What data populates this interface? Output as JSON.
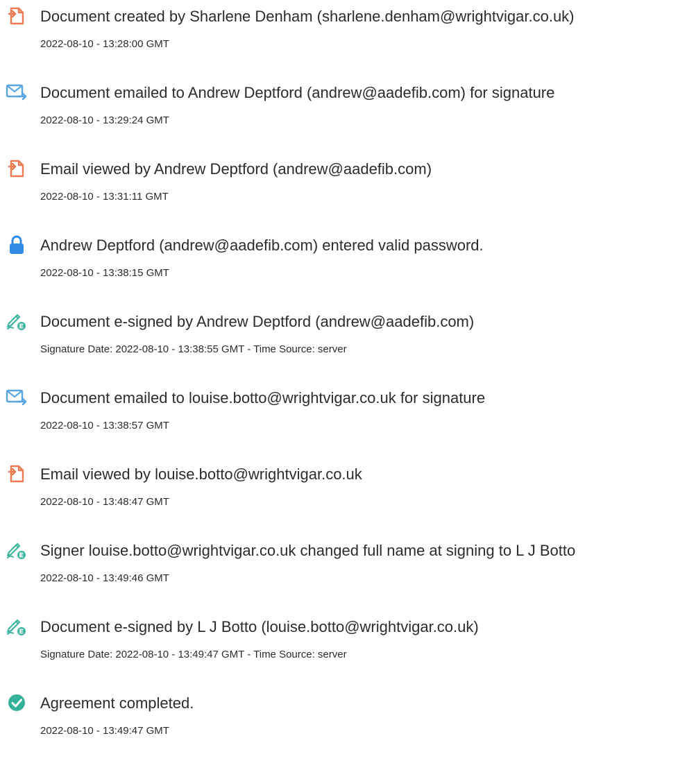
{
  "events": [
    {
      "icon": "document-icon",
      "title": "Document created by Sharlene Denham (sharlene.denham@wrightvigar.co.uk)",
      "meta": "2022-08-10 - 13:28:00 GMT"
    },
    {
      "icon": "email-sent-icon",
      "title": "Document emailed to Andrew Deptford (andrew@aadefib.com) for signature",
      "meta": "2022-08-10 - 13:29:24 GMT"
    },
    {
      "icon": "document-icon",
      "title": "Email viewed by Andrew Deptford (andrew@aadefib.com)",
      "meta": "2022-08-10 - 13:31:11 GMT"
    },
    {
      "icon": "lock-icon",
      "title": "Andrew Deptford (andrew@aadefib.com) entered valid password.",
      "meta": "2022-08-10 - 13:38:15 GMT"
    },
    {
      "icon": "e-sign-pen-icon",
      "title": "Document e-signed by Andrew Deptford (andrew@aadefib.com)",
      "meta": "Signature Date: 2022-08-10 - 13:38:55 GMT - Time Source: server"
    },
    {
      "icon": "email-sent-icon",
      "title": "Document emailed to louise.botto@wrightvigar.co.uk for signature",
      "meta": "2022-08-10 - 13:38:57 GMT"
    },
    {
      "icon": "document-icon",
      "title": "Email viewed by louise.botto@wrightvigar.co.uk",
      "meta": "2022-08-10 - 13:48:47 GMT"
    },
    {
      "icon": "e-sign-pen-icon",
      "title": "Signer louise.botto@wrightvigar.co.uk changed full name at signing to L J Botto",
      "meta": "2022-08-10 - 13:49:46 GMT"
    },
    {
      "icon": "e-sign-pen-icon",
      "title": "Document e-signed by L J Botto (louise.botto@wrightvigar.co.uk)",
      "meta": "Signature Date: 2022-08-10 - 13:49:47 GMT - Time Source: server"
    },
    {
      "icon": "checkmark-circle-icon",
      "title": "Agreement completed.",
      "meta": "2022-08-10 - 13:49:47 GMT"
    }
  ],
  "colors": {
    "document": "#ee7a52",
    "email": "#5aa6e0",
    "lock": "#2f8be6",
    "pen": "#3fb6a1",
    "check": "#35b39a",
    "text": "#2c2c2c"
  }
}
